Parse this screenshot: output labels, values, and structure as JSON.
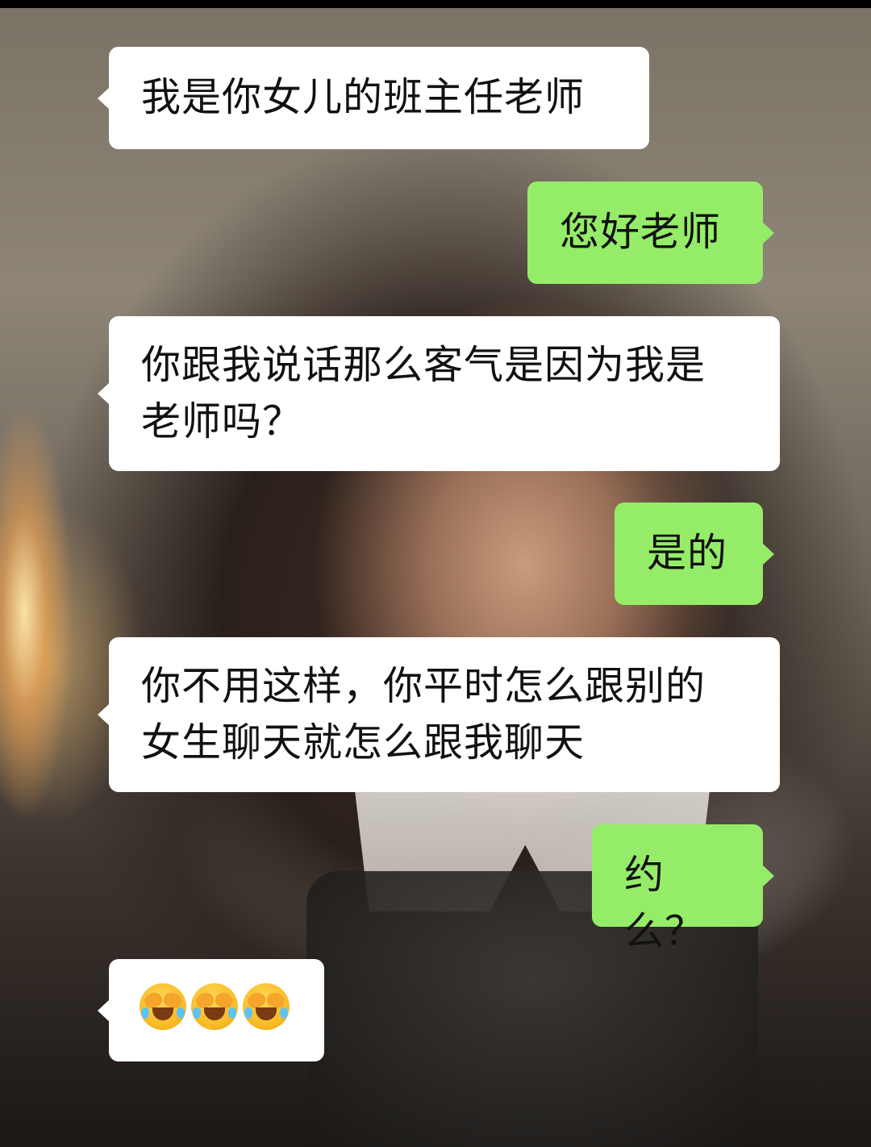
{
  "messages": [
    {
      "sender": "other",
      "text": "我是你女儿的班主任老师"
    },
    {
      "sender": "self",
      "text": "您好老师"
    },
    {
      "sender": "other",
      "text": "你跟我说话那么客气是因为我是\n老师吗？"
    },
    {
      "sender": "self",
      "text": "是的"
    },
    {
      "sender": "other",
      "text": "你不用这样，你平时怎么跟别的\n女生聊天就怎么跟我聊天"
    },
    {
      "sender": "self",
      "text": "约么？"
    },
    {
      "sender": "other",
      "emoji": [
        "loudly-crying-face-icon",
        "loudly-crying-face-icon",
        "loudly-crying-face-icon"
      ]
    }
  ],
  "colors": {
    "incoming_bubble": "#ffffff",
    "outgoing_bubble": "#95ec69",
    "text": "#111111"
  }
}
